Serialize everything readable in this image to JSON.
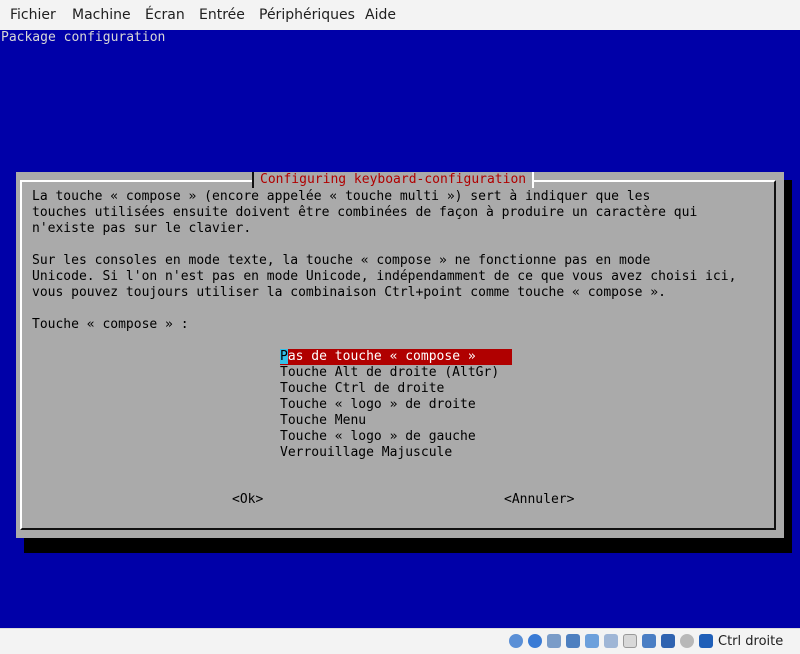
{
  "menu": {
    "fichier": "Fichier",
    "machine": "Machine",
    "ecran": "Écran",
    "entree": "Entrée",
    "peripheriques": "Périphériques",
    "aide": "Aide"
  },
  "screen": {
    "package_title": "Package configuration"
  },
  "dialog": {
    "title": "Configuring keyboard-configuration",
    "paragraph1": [
      "La touche « compose » (encore appelée « touche multi ») sert à indiquer que les",
      "touches utilisées ensuite doivent être combinées de façon à produire un caractère qui",
      "n'existe pas sur le clavier."
    ],
    "paragraph2": [
      "Sur les consoles en mode texte, la touche « compose » ne fonctionne pas en mode",
      "Unicode. Si l'on n'est pas en mode Unicode, indépendamment de ce que vous avez choisi ici,",
      "vous pouvez toujours utiliser la combinaison Ctrl+point comme touche « compose »."
    ],
    "prompt": "Touche « compose » :",
    "options": [
      "Pas de touche « compose »",
      "Touche Alt de droite (AltGr)",
      "Touche Ctrl de droite",
      "Touche « logo » de droite",
      "Touche Menu",
      "Touche « logo » de gauche",
      "Verrouillage Majuscule"
    ],
    "selected_option_first_char": "P",
    "selected_option_rest": "as de touche « compose »",
    "ok_label": "<Ok>",
    "cancel_label": "<Annuler>"
  },
  "statusbar": {
    "icons": [
      "hdd-icon",
      "optical-drive-icon",
      "audio-icon",
      "network-icon",
      "usb-icon",
      "shared-folders-icon",
      "display-icon",
      "video-capture-icon",
      "mouse-integration-icon",
      "cpu-icon",
      "keyboard-capture-icon"
    ],
    "host_key_label": "Ctrl droite"
  },
  "colors": {
    "screen_bg": "#0000a8",
    "dialog_bg": "#aaaaaa",
    "title_fg": "#b00000",
    "selection_bg": "#b00000",
    "cursor_bg": "#35c0e8"
  }
}
